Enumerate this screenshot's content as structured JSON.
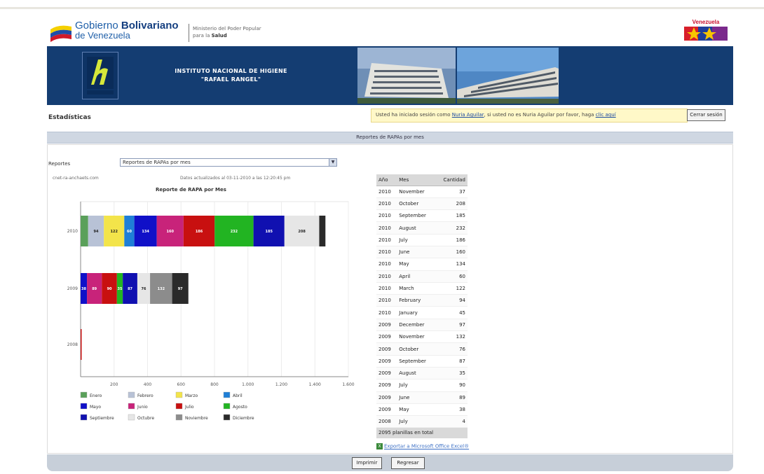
{
  "gov_header": {
    "line1_normal": "Gobierno",
    "line1_bold": "Bolivariano",
    "line2": "de Venezuela",
    "ministry_line1": "Ministerio del Poder Popular",
    "ministry_line2_prefix": "para la",
    "ministry_line2_bold": "Salud",
    "right_logo_text": "Venezuela"
  },
  "banner": {
    "title_line1": "INSTITUTO NACIONAL DE HIGIENE",
    "title_line2": "\"RAFAEL RANGEL\""
  },
  "breadcrumb": "Estadísticas",
  "session_notice": {
    "prefix": "Usted ha iniciado sesión como",
    "user": "Nuria Aguilar",
    "middle": ", si usted no es Nuria Aguilar por favor, haga",
    "link": "clic aquí",
    "logout_label": "Cerrar sesión"
  },
  "section_title": "Reportes de RAPAs por mes",
  "reports": {
    "label": "Reportes",
    "selected": "Reportes de RAPAs por mes"
  },
  "chart_meta": {
    "credit": "cnet-ra-anchaets.com",
    "updated": "Datos actualizados al 03-11-2010 a las 12:20:45 pm",
    "title": "Reporte de RAPA por Mes"
  },
  "chart_data": {
    "type": "bar",
    "orientation": "horizontal",
    "stacked": true,
    "title": "Reporte de RAPA por Mes",
    "categories": [
      "2010",
      "2009",
      "2008"
    ],
    "xlim": [
      0,
      1600
    ],
    "x_ticks": [
      "200",
      "400",
      "600",
      "800",
      "1.000",
      "1.200",
      "1.400",
      "1.600"
    ],
    "series": [
      {
        "name": "Enero",
        "color": "#5aa05a",
        "values": [
          45,
          0,
          0
        ]
      },
      {
        "name": "Febrero",
        "color": "#b8c2d6",
        "values": [
          94,
          0,
          0
        ]
      },
      {
        "name": "Marzo",
        "color": "#f3e44a",
        "values": [
          122,
          0,
          0
        ]
      },
      {
        "name": "Abril",
        "color": "#1f7fd6",
        "values": [
          60,
          0,
          0
        ]
      },
      {
        "name": "Mayo",
        "color": "#1010c8",
        "values": [
          134,
          38,
          0
        ]
      },
      {
        "name": "Junio",
        "color": "#c8237a",
        "values": [
          160,
          89,
          0
        ]
      },
      {
        "name": "Julio",
        "color": "#c81010",
        "values": [
          186,
          90,
          4
        ]
      },
      {
        "name": "Agosto",
        "color": "#22b422",
        "values": [
          232,
          35,
          0
        ]
      },
      {
        "name": "Septiembre",
        "color": "#1010b0",
        "values": [
          185,
          87,
          0
        ]
      },
      {
        "name": "Octubre",
        "color": "#e6e6e6",
        "values": [
          208,
          76,
          0
        ]
      },
      {
        "name": "Noviembre",
        "color": "#8c8c8c",
        "values": [
          0,
          132,
          0
        ]
      },
      {
        "name": "Diciembre",
        "color": "#2a2a2a",
        "values": [
          37,
          97,
          0
        ]
      }
    ],
    "bar_labels": [
      [
        "",
        "94",
        "122",
        "60",
        "134",
        "160",
        "186",
        "232",
        "185",
        "208",
        "",
        ""
      ],
      [
        "",
        "",
        "",
        "",
        "38",
        "89",
        "90",
        "35",
        "87",
        "76",
        "132",
        "97"
      ],
      [
        "",
        "",
        "",
        "",
        "",
        "",
        "",
        "",
        "",
        "",
        "",
        ""
      ]
    ],
    "legend_position": "bottom"
  },
  "table": {
    "headers": [
      "Año",
      "Mes",
      "Cantidad"
    ],
    "rows": [
      [
        "2010",
        "November",
        "37"
      ],
      [
        "2010",
        "October",
        "208"
      ],
      [
        "2010",
        "September",
        "185"
      ],
      [
        "2010",
        "August",
        "232"
      ],
      [
        "2010",
        "July",
        "186"
      ],
      [
        "2010",
        "June",
        "160"
      ],
      [
        "2010",
        "May",
        "134"
      ],
      [
        "2010",
        "April",
        "60"
      ],
      [
        "2010",
        "March",
        "122"
      ],
      [
        "2010",
        "February",
        "94"
      ],
      [
        "2010",
        "January",
        "45"
      ],
      [
        "2009",
        "December",
        "97"
      ],
      [
        "2009",
        "November",
        "132"
      ],
      [
        "2009",
        "October",
        "76"
      ],
      [
        "2009",
        "September",
        "87"
      ],
      [
        "2009",
        "August",
        "35"
      ],
      [
        "2009",
        "July",
        "90"
      ],
      [
        "2009",
        "June",
        "89"
      ],
      [
        "2009",
        "May",
        "38"
      ],
      [
        "2008",
        "July",
        "4"
      ]
    ],
    "total": "2095 planillas en total"
  },
  "export_link": "Exportar a Microsoft Office Excel®",
  "buttons": {
    "print": "Imprimir",
    "back": "Regresar"
  }
}
